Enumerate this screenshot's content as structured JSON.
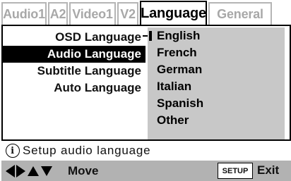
{
  "tabs": [
    {
      "label": "Audio1"
    },
    {
      "label": "A2"
    },
    {
      "label": "Video1"
    },
    {
      "label": "V2"
    },
    {
      "label": "Language",
      "active": true
    },
    {
      "label": "General"
    }
  ],
  "menu": {
    "items": [
      {
        "label": "OSD Language"
      },
      {
        "label": "Audio Language",
        "selected": true
      },
      {
        "label": "Subtitle Language"
      },
      {
        "label": "Auto Language"
      }
    ]
  },
  "submenu": {
    "options": [
      {
        "label": "English",
        "current": true
      },
      {
        "label": "French"
      },
      {
        "label": "German"
      },
      {
        "label": "Italian"
      },
      {
        "label": "Spanish"
      },
      {
        "label": "Other"
      }
    ]
  },
  "help": {
    "icon": "info-icon",
    "text": "Setup audio language"
  },
  "bottom": {
    "arrow_icons": [
      "left-arrow-icon",
      "right-arrow-icon",
      "up-arrow-icon",
      "down-arrow-icon"
    ],
    "move_label": "Move",
    "setup_label": "SETUP",
    "exit_label": "Exit"
  },
  "colors": {
    "selected_bg": "#000000",
    "submenu_bg": "#c8c8c8",
    "bottombar_bg": "#b2b2b2",
    "inactive_tab_text": "#a8a8a8"
  }
}
